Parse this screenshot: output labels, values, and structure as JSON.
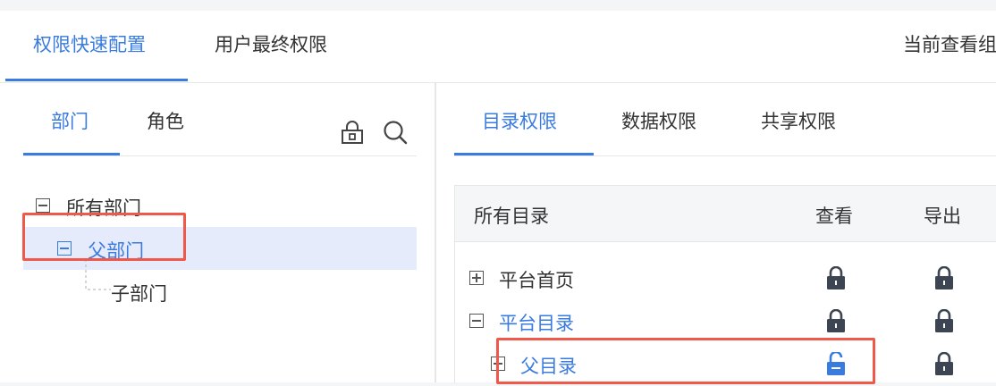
{
  "top_tabs": {
    "quick_config": "权限快速配置",
    "user_final": "用户最终权限"
  },
  "view_info": "当前查看组",
  "left": {
    "tabs": {
      "department": "部门",
      "role": "角色"
    },
    "tree": {
      "all_departments": "所有部门",
      "parent_department": "父部门",
      "child_department": "子部门"
    }
  },
  "right": {
    "tabs": {
      "catalog": "目录权限",
      "data": "数据权限",
      "share": "共享权限"
    },
    "table": {
      "headers": {
        "name": "所有目录",
        "view": "查看",
        "export": "导出"
      },
      "rows": {
        "platform_home": "平台首页",
        "platform_catalog": "平台目录",
        "parent_catalog": "父目录"
      }
    }
  },
  "colors": {
    "accent": "#3a7be0",
    "highlight_box": "#f0584a",
    "lock": "#3d4552",
    "selected_row": "#e5ebfa"
  }
}
